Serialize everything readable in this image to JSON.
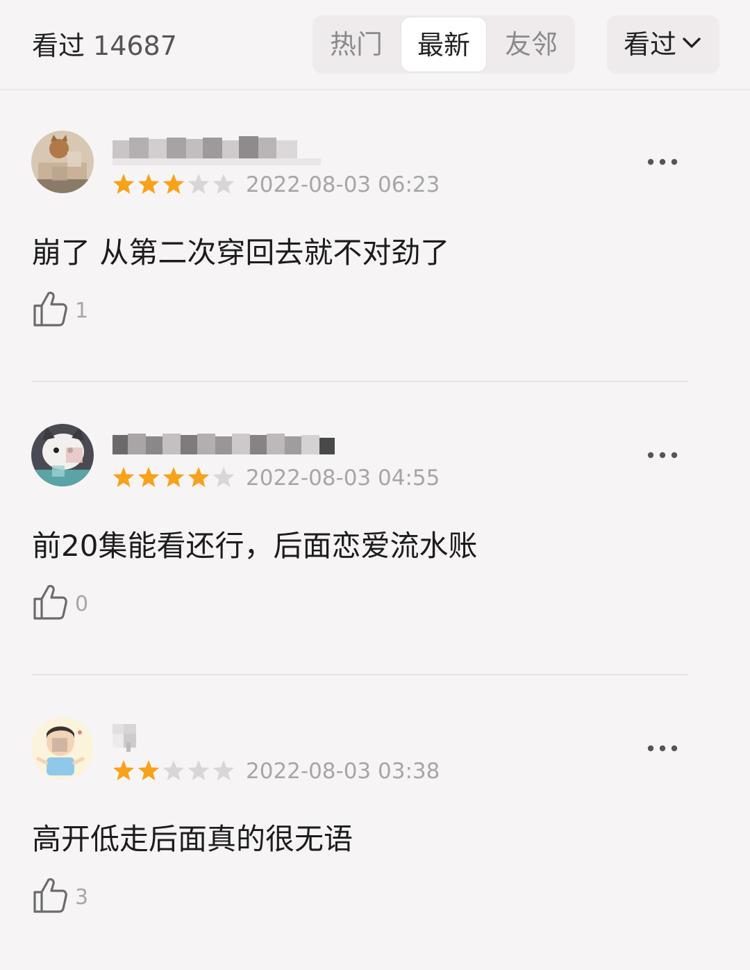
{
  "header": {
    "watched_label": "看过",
    "watched_count": "14687",
    "tabs": [
      {
        "label": "热门",
        "selected": false
      },
      {
        "label": "最新",
        "selected": true
      },
      {
        "label": "友邻",
        "selected": false
      }
    ],
    "filter_label": "看过",
    "filter_icon": "chevron-down-icon"
  },
  "colors": {
    "background": "#f7f4f5",
    "star_filled": "#f7a21b",
    "star_empty": "#d9d6d7",
    "muted_text": "#a6a6a6"
  },
  "reviews": [
    {
      "rating": 3,
      "max_rating": 5,
      "timestamp": "2022-08-03 06:23",
      "comment": "崩了 从第二次穿回去就不对劲了",
      "likes": "1"
    },
    {
      "rating": 4,
      "max_rating": 5,
      "timestamp": "2022-08-03 04:55",
      "comment": "前20集能看还行，后面恋爱流水账",
      "likes": "0"
    },
    {
      "rating": 2,
      "max_rating": 5,
      "timestamp": "2022-08-03 03:38",
      "comment": "高开低走后面真的很无语",
      "likes": "3"
    }
  ]
}
